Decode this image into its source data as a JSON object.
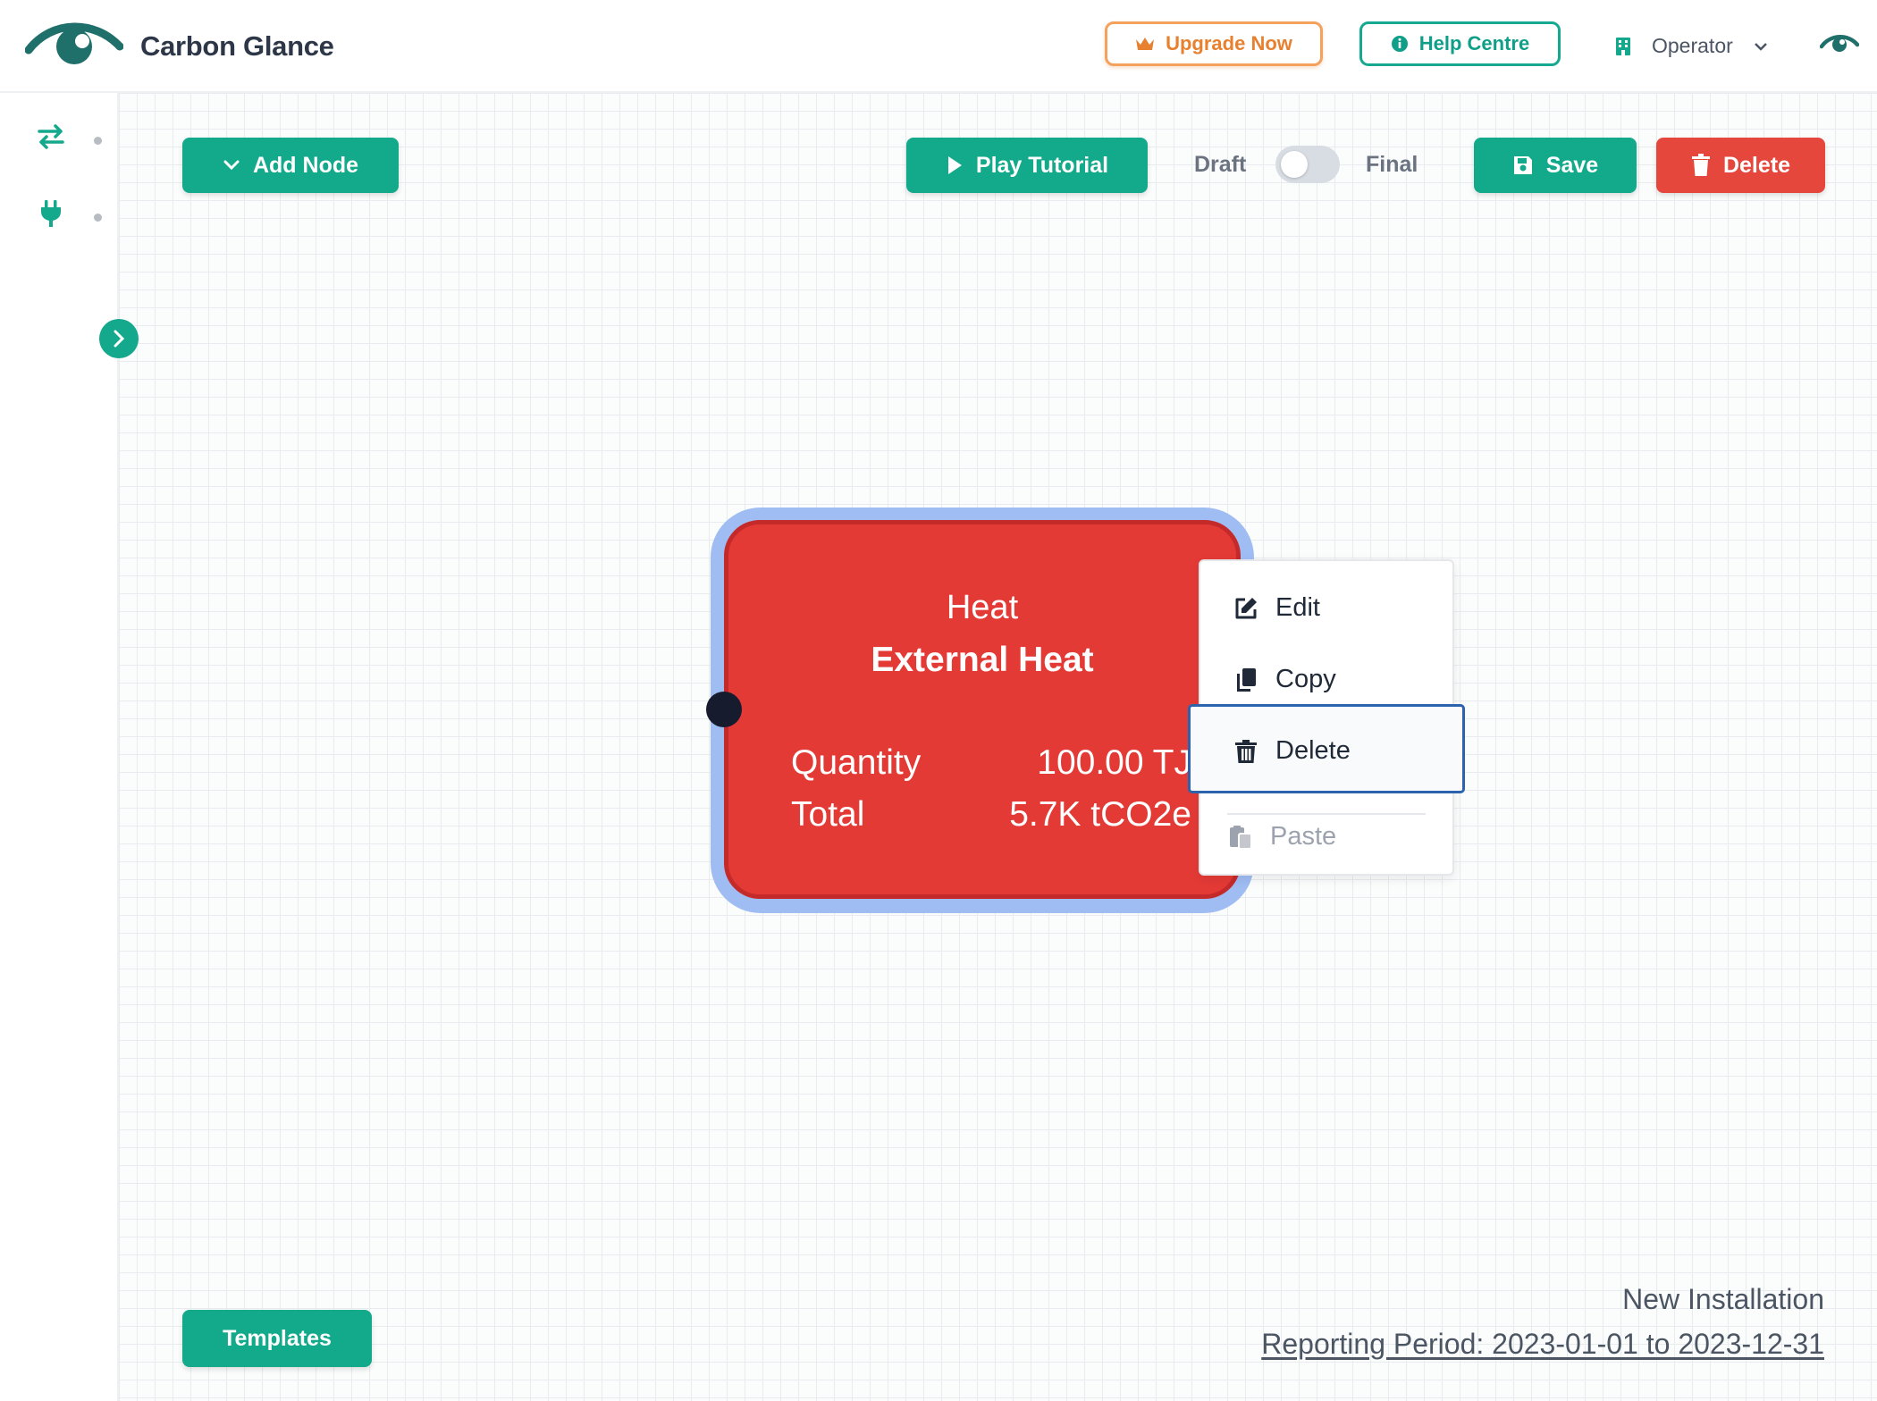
{
  "header": {
    "brand": "Carbon Glance",
    "upgrade_label": "Upgrade Now",
    "help_label": "Help Centre",
    "role_label": "Operator"
  },
  "toolbar": {
    "add_node_label": "Add Node",
    "play_tutorial_label": "Play Tutorial",
    "toggle_left_label": "Draft",
    "toggle_right_label": "Final",
    "toggle_state": "Draft",
    "save_label": "Save",
    "delete_label": "Delete"
  },
  "node": {
    "type": "Heat",
    "name": "External Heat",
    "rows": [
      {
        "label": "Quantity",
        "value": "100.00 TJ"
      },
      {
        "label": "Total",
        "value": "5.7K tCO2e"
      }
    ],
    "color": "#e43a36",
    "selected_outline_color": "#9fbcf3"
  },
  "context_menu": {
    "items": [
      {
        "label": "Edit",
        "icon": "edit-icon"
      },
      {
        "label": "Copy",
        "icon": "copy-icon"
      },
      {
        "label": "Delete",
        "icon": "trash-icon",
        "focused": true
      },
      {
        "label": "Paste",
        "icon": "paste-icon",
        "disabled": true
      }
    ]
  },
  "footer": {
    "templates_label": "Templates",
    "installation_name": "New Installation",
    "reporting_period": "Reporting Period: 2023-01-01 to 2023-12-31"
  },
  "colors": {
    "brand_green": "#13a98b",
    "danger_red": "#e5473c",
    "upgrade_orange": "#e8812f"
  }
}
